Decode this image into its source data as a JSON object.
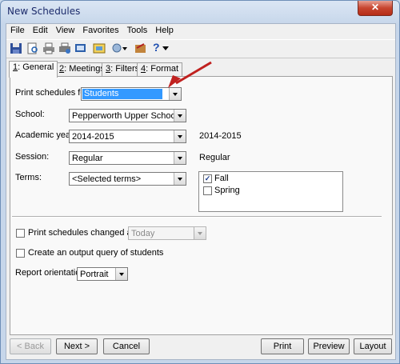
{
  "window": {
    "title": "New Schedules",
    "close_label": "✕"
  },
  "menu": {
    "items": [
      "File",
      "Edit",
      "View",
      "Favorites",
      "Tools",
      "Help"
    ]
  },
  "toolbar": {
    "help_label": "?"
  },
  "tabs": [
    {
      "key": "1",
      "label": ": General"
    },
    {
      "key": "2",
      "label": ": Meetings"
    },
    {
      "key": "3",
      "label": ": Filters"
    },
    {
      "key": "4",
      "label": ": Format"
    }
  ],
  "form": {
    "print_for": {
      "label": "Print schedules for:",
      "value": "Students"
    },
    "school": {
      "label": "School:",
      "value": "Pepperworth Upper School"
    },
    "academic_year": {
      "label": "Academic year:",
      "value": "2014-2015",
      "display": "2014-2015"
    },
    "session": {
      "label": "Session:",
      "value": "Regular",
      "display": "Regular"
    },
    "terms": {
      "label": "Terms:",
      "value": "<Selected terms>",
      "options": [
        {
          "label": "Fall",
          "checked": true
        },
        {
          "label": "Spring",
          "checked": false
        }
      ]
    },
    "changed_as_of": {
      "label": "Print schedules changed as of",
      "checked": false,
      "value": "Today"
    },
    "output_query": {
      "label": "Create an output query of students",
      "checked": false
    },
    "orientation": {
      "label": "Report orientation:",
      "value": "Portrait"
    }
  },
  "buttons": {
    "back": "< Back",
    "next": "Next >",
    "cancel": "Cancel",
    "print": "Print",
    "preview": "Preview",
    "layout": "Layout"
  },
  "colors": {
    "selection": "#3399ff",
    "annotation_arrow": "#c0211f",
    "title_text": "#1c2b6b"
  }
}
